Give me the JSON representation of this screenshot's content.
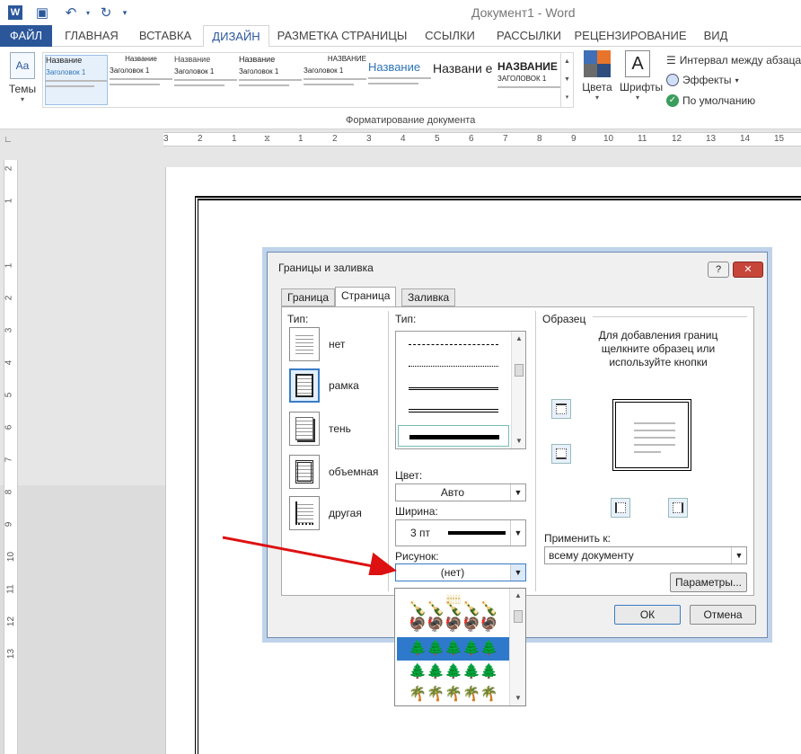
{
  "window": {
    "title": "Документ1 - Word"
  },
  "quick_access": [
    "word-logo-icon",
    "save-icon",
    "undo-icon",
    "redo-icon",
    "customize-icon"
  ],
  "tabs": [
    {
      "label": "ФАЙЛ"
    },
    {
      "label": "ГЛАВНАЯ"
    },
    {
      "label": "ВСТАВКА"
    },
    {
      "label": "ДИЗАЙН"
    },
    {
      "label": "РАЗМЕТКА СТРАНИЦЫ"
    },
    {
      "label": "ССЫЛКИ"
    },
    {
      "label": "РАССЫЛКИ"
    },
    {
      "label": "РЕЦЕНЗИРОВАНИЕ"
    },
    {
      "label": "ВИД"
    }
  ],
  "ribbon": {
    "themes": "Темы",
    "gallery": [
      {
        "title": "Название",
        "sub": "Заголовок 1"
      },
      {
        "title": "Название",
        "sub": "Заголовок 1"
      },
      {
        "title": "Название",
        "sub": "Заголовок 1"
      },
      {
        "title": "Название",
        "sub": "Заголовок 1"
      },
      {
        "title": "НАЗВАНИЕ",
        "sub": "Заголовок 1"
      },
      {
        "title": "Название",
        "sub": ""
      },
      {
        "title": "Названи е",
        "sub": ""
      },
      {
        "title": "НАЗВАНИЕ",
        "sub": "ЗАГОЛОВОК 1"
      }
    ],
    "group_label": "Форматирование документа",
    "colors": "Цвета",
    "fonts": "Шрифты",
    "fonts_glyph": "A",
    "paragraph_spacing": "Интервал между абзаца",
    "effects": "Эффекты",
    "set_default": "По умолчанию",
    "color_swatches": [
      "#3f6fb7",
      "#e8742a",
      "#6b6b6b",
      "#2e4e7e"
    ]
  },
  "ruler": {
    "h_numbers": [
      "3",
      "2",
      "1",
      "1",
      "2",
      "3",
      "4",
      "5",
      "6",
      "7",
      "8",
      "9",
      "10",
      "11",
      "12",
      "13",
      "14",
      "15"
    ],
    "v_numbers": [
      "2",
      "1",
      "1",
      "2",
      "3",
      "4",
      "5",
      "6",
      "7",
      "8",
      "9",
      "10",
      "11",
      "12",
      "13"
    ]
  },
  "dialog": {
    "title": "Границы и заливка",
    "help": "?",
    "close": "✕",
    "tabs": [
      "Граница",
      "Страница",
      "Заливка"
    ],
    "type_label": "Тип:",
    "types": [
      "нет",
      "рамка",
      "тень",
      "объемная",
      "другая"
    ],
    "style_label": "Тип:",
    "color_label": "Цвет:",
    "color_value": "Авто",
    "width_label": "Ширина:",
    "width_value": "3 пт",
    "art_label": "Рисунок:",
    "art_value": "(нет)",
    "preview_label": "Образец",
    "preview_hint": "Для добавления границ щелкните образец или используйте кнопки",
    "apply_label": "Применить к:",
    "apply_value": "всему документу",
    "options_button": "Параметры...",
    "ok": "ОК",
    "cancel": "Отмена"
  },
  "art_dropdown": [
    {
      "glyphs": "🕯🕯🕯🕯🕯",
      "color": "#c09000"
    },
    {
      "glyphs": "🍾🍾🍾🍾🍾",
      "color": "#2a8a2a"
    },
    {
      "glyphs": "🦃🦃🦃🦃🦃",
      "color": "#7a2a1a"
    },
    {
      "glyphs": "🌲🌲🌲🌲🌲",
      "color": "#1a8a1a"
    },
    {
      "glyphs": "🌲🌲🌲🌲🌲",
      "color": "#123"
    },
    {
      "glyphs": "🌴🌴🌴🌴🌴",
      "color": "#333"
    }
  ]
}
